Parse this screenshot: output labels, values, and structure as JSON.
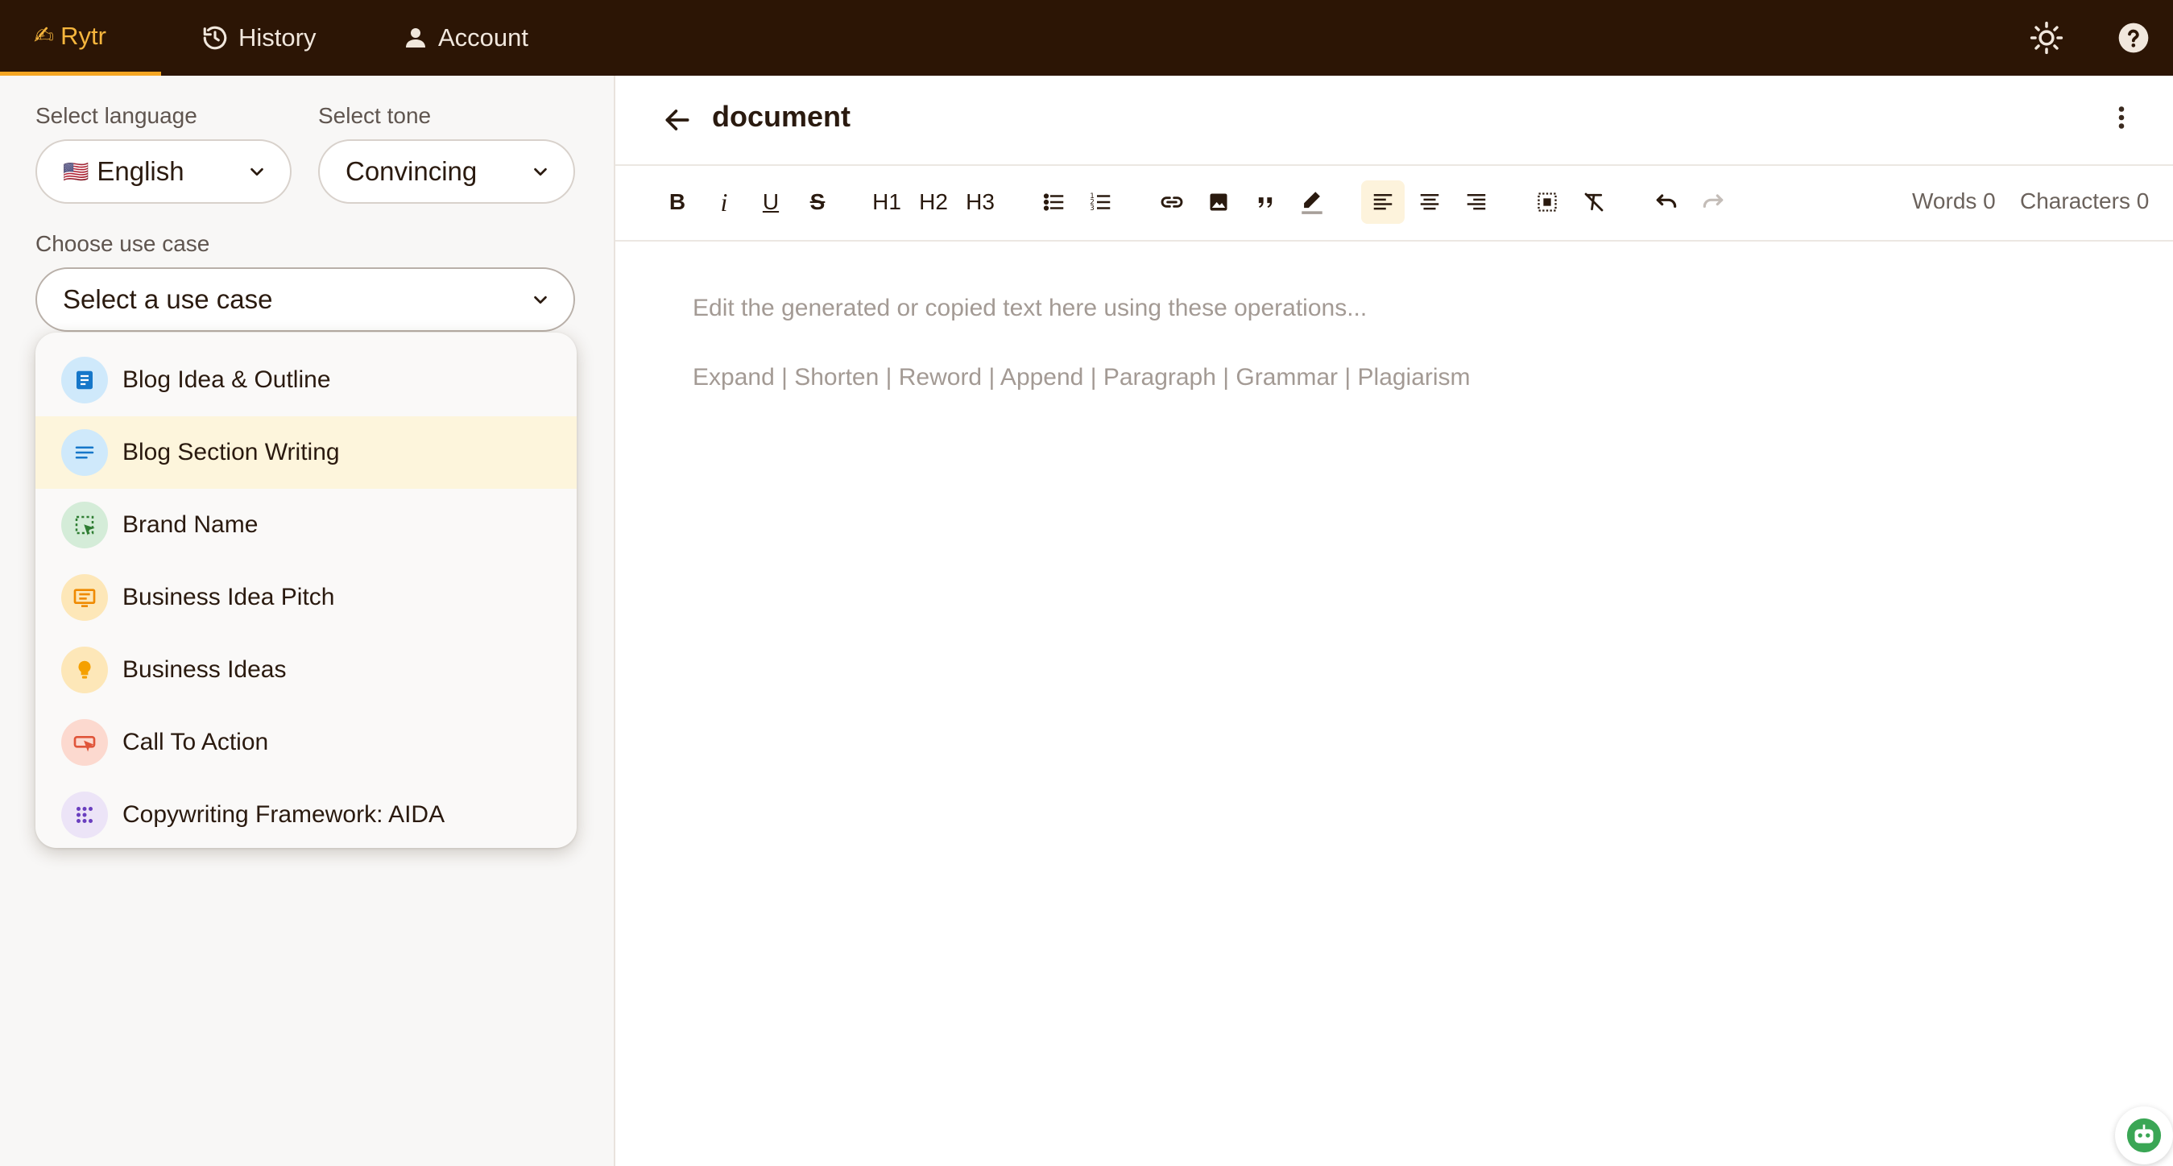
{
  "nav": {
    "brand": "Rytr",
    "history": "History",
    "account": "Account"
  },
  "sidebar": {
    "language_label": "Select language",
    "language_value": "English",
    "language_flag": "🇺🇸",
    "tone_label": "Select tone",
    "tone_value": "Convincing",
    "usecase_label": "Choose use case",
    "usecase_value": "Select a use case",
    "usecases": [
      {
        "label": "Blog Idea & Outline",
        "icon": "document-icon",
        "bg": "#cfe9fb",
        "fg": "#1677c9"
      },
      {
        "label": "Blog Section Writing",
        "icon": "lines-icon",
        "bg": "#cfe9fb",
        "fg": "#1677c9",
        "highlighted": true
      },
      {
        "label": "Brand Name",
        "icon": "select-area-icon",
        "bg": "#d4ecd8",
        "fg": "#2e7d32"
      },
      {
        "label": "Business Idea Pitch",
        "icon": "presentation-icon",
        "bg": "#fde7b8",
        "fg": "#ef8a00"
      },
      {
        "label": "Business Ideas",
        "icon": "lightbulb-icon",
        "bg": "#fde7b8",
        "fg": "#f5a000"
      },
      {
        "label": "Call To Action",
        "icon": "click-button-icon",
        "bg": "#fcd9cf",
        "fg": "#e0553a"
      },
      {
        "label": "Copywriting Framework: AIDA",
        "icon": "dots-grid-icon",
        "bg": "#ece4f7",
        "fg": "#6a3fbf"
      }
    ]
  },
  "editor": {
    "title": "document",
    "toolbar": {
      "h1": "H1",
      "h2": "H2",
      "h3": "H3",
      "words": "Words 0",
      "characters": "Characters 0"
    },
    "placeholder_line1": "Edit the generated or copied text here using these operations...",
    "placeholder_line2": "Expand | Shorten | Reword | Append | Paragraph | Grammar | Plagiarism"
  },
  "colors": {
    "topbar": "#2c1505",
    "accent": "#f5a623",
    "highlight": "#fdf5dc"
  }
}
